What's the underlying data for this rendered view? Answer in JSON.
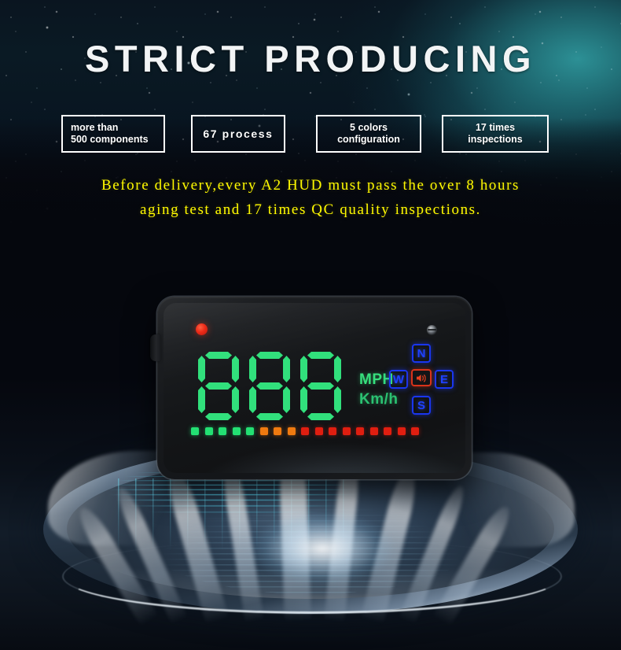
{
  "header": {
    "title": "STRICT PRODUCING"
  },
  "feature_boxes": [
    {
      "line1": "more than",
      "line2": "500 components"
    },
    {
      "line1": "67 process",
      "line2": ""
    },
    {
      "line1": "5 colors",
      "line2": "configuration"
    },
    {
      "line1": "17 times",
      "line2": "inspections"
    }
  ],
  "description": {
    "line1": "Before delivery,every A2 HUD must pass the over 8 hours",
    "line2": "aging test and 17 times QC quality inspections."
  },
  "device": {
    "speed_display": "888",
    "digits": [
      "8",
      "8",
      "8"
    ],
    "unit_primary": "MPH",
    "unit_secondary": "Km/h",
    "compass": {
      "north": "N",
      "west": "W",
      "east": "E",
      "south": "S",
      "center_icon": "speaker-mute-icon"
    },
    "status_led": "red-power-led",
    "sensor": "light-sensor",
    "side_button": "side-button",
    "bar_graph": {
      "total_segments": 17,
      "segments": [
        "green",
        "green",
        "green",
        "green",
        "green",
        "orange",
        "orange",
        "orange",
        "red",
        "red",
        "red",
        "red",
        "red",
        "red",
        "red",
        "red",
        "red"
      ]
    }
  },
  "colors": {
    "title_text": "#f2f4f5",
    "box_border": "#ffffff",
    "box_text": "#ffffff",
    "description_text": "#fffa00",
    "nebula_teal": "#2e969b",
    "background_dark": "#05070d",
    "led_green": "#31e07c",
    "led_orange": "#ef7a10",
    "led_red": "#e01e10",
    "compass_blue": "#1f42ff",
    "mute_red": "#d8331a",
    "holo_cyan": "#5ae1ff"
  },
  "stage": {
    "platter": "metallic-display-platter",
    "projection": "holographic-light-beams"
  }
}
